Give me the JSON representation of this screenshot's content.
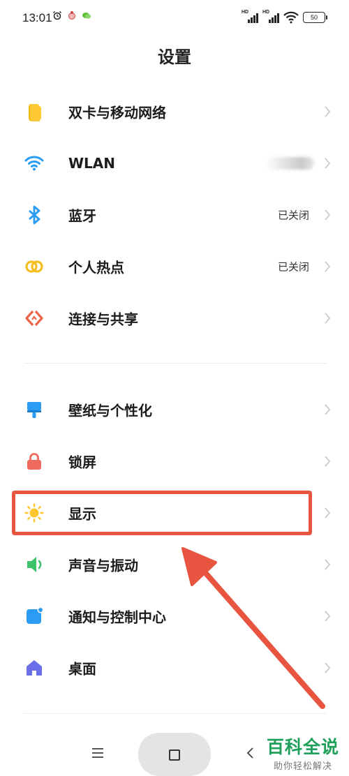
{
  "status_bar": {
    "time": "13:01",
    "battery": "50"
  },
  "page_title": "设置",
  "items": [
    {
      "label": "双卡与移动网络",
      "icon": "sim-card-icon",
      "status": ""
    },
    {
      "label": "WLAN",
      "icon": "wifi-icon",
      "status": ""
    },
    {
      "label": "蓝牙",
      "icon": "bluetooth-icon",
      "status": "已关闭"
    },
    {
      "label": "个人热点",
      "icon": "hotspot-icon",
      "status": "已关闭"
    },
    {
      "label": "连接与共享",
      "icon": "connection-share-icon",
      "status": ""
    },
    {
      "label": "壁纸与个性化",
      "icon": "paint-brush-icon",
      "status": ""
    },
    {
      "label": "锁屏",
      "icon": "lock-icon",
      "status": ""
    },
    {
      "label": "显示",
      "icon": "sun-icon",
      "status": ""
    },
    {
      "label": "声音与振动",
      "icon": "speaker-icon",
      "status": ""
    },
    {
      "label": "通知与控制中心",
      "icon": "notification-icon",
      "status": ""
    },
    {
      "label": "桌面",
      "icon": "home-icon",
      "status": ""
    }
  ],
  "watermark": {
    "title": "百科全说",
    "subtitle": "助你轻松解决"
  },
  "colors": {
    "highlight": "#e8543f",
    "watermark": "#1ea05a"
  }
}
